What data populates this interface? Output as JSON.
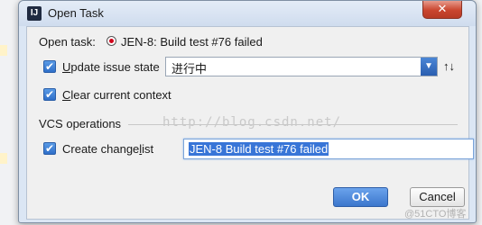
{
  "window": {
    "title": "Open Task",
    "app_icon_text": "IJ",
    "close_glyph": "✕"
  },
  "task": {
    "label": "Open task:",
    "value": "JEN-8: Build test #76 failed",
    "status_icon": "red-dot-icon"
  },
  "update_state": {
    "checked": true,
    "label_prefix": "",
    "label_mnemonic": "U",
    "label_rest": "pdate issue state",
    "selected_value": "进行中"
  },
  "clear_context": {
    "checked": true,
    "label_mnemonic": "C",
    "label_rest": "lear current context"
  },
  "vcs": {
    "section_label": "VCS operations",
    "create_changelist": {
      "checked": true,
      "label_prefix": "Create change",
      "label_mnemonic": "l",
      "label_rest": "ist",
      "value": "JEN-8 Build test #76 failed"
    }
  },
  "buttons": {
    "ok": "OK",
    "cancel": "Cancel"
  },
  "watermark": {
    "center": "http://blog.csdn.net/",
    "corner": "@51CTO博客"
  },
  "icons": {
    "check": "✔",
    "dropdown_arrow": "▼",
    "sort": "↑↓"
  },
  "colors": {
    "accent": "#3875d7",
    "status_red": "#d0021b",
    "close_red": "#c9452e"
  }
}
